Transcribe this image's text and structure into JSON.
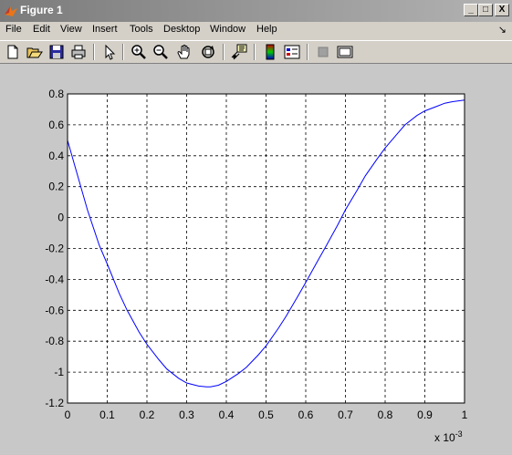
{
  "window": {
    "title": "Figure 1",
    "controls": {
      "minimize": "_",
      "maximize": "□",
      "close": "X"
    }
  },
  "menu": {
    "items": [
      "File",
      "Edit",
      "View",
      "Insert",
      "Tools",
      "Desktop",
      "Window",
      "Help"
    ],
    "dock_arrow": "↘"
  },
  "toolbar": {
    "icons": [
      "new-figure-icon",
      "open-file-icon",
      "save-icon",
      "print-icon",
      "edit-plot-arrow-icon",
      "zoom-in-icon",
      "zoom-out-icon",
      "pan-hand-icon",
      "rotate-3d-icon",
      "data-cursor-icon",
      "colorbar-icon",
      "legend-icon",
      "hide-plot-tools-icon",
      "show-plot-tools-icon"
    ]
  },
  "colors": {
    "line": "#0000ff",
    "plot_bg": "#ffffff",
    "figure_bg": "#c8c8c8",
    "titlebar_start": "#7b7b7b",
    "titlebar_end": "#b3b3b3"
  },
  "chart_data": {
    "type": "line",
    "title": "",
    "xlabel": "",
    "ylabel": "",
    "x_multiplier": "x 10",
    "x_multiplier_exp": "-3",
    "xlim": [
      0,
      1
    ],
    "ylim": [
      -1.2,
      0.8
    ],
    "grid": true,
    "x_ticks": [
      "0",
      "0.1",
      "0.2",
      "0.3",
      "0.4",
      "0.5",
      "0.6",
      "0.7",
      "0.8",
      "0.9",
      "1"
    ],
    "y_ticks": [
      "0.8",
      "0.6",
      "0.4",
      "0.2",
      "0",
      "-0.2",
      "-0.4",
      "-0.6",
      "-0.8",
      "-1",
      "-1.2"
    ],
    "series": [
      {
        "x": [
          0,
          0.02,
          0.05,
          0.08,
          0.1,
          0.13,
          0.15,
          0.18,
          0.2,
          0.23,
          0.25,
          0.28,
          0.3,
          0.33,
          0.35,
          0.36,
          0.38,
          0.4,
          0.43,
          0.45,
          0.48,
          0.5,
          0.53,
          0.55,
          0.58,
          0.6,
          0.63,
          0.65,
          0.68,
          0.7,
          0.73,
          0.75,
          0.78,
          0.8,
          0.83,
          0.85,
          0.88,
          0.9,
          0.93,
          0.95,
          0.97,
          1
        ],
        "y": [
          0.5,
          0.32,
          0.05,
          -0.18,
          -0.3,
          -0.49,
          -0.6,
          -0.74,
          -0.82,
          -0.92,
          -0.98,
          -1.04,
          -1.07,
          -1.09,
          -1.095,
          -1.095,
          -1.085,
          -1.06,
          -1.01,
          -0.97,
          -0.89,
          -0.83,
          -0.72,
          -0.64,
          -0.51,
          -0.42,
          -0.28,
          -0.19,
          -0.05,
          0.05,
          0.18,
          0.27,
          0.38,
          0.45,
          0.54,
          0.6,
          0.66,
          0.69,
          0.72,
          0.74,
          0.75,
          0.76
        ]
      }
    ]
  }
}
